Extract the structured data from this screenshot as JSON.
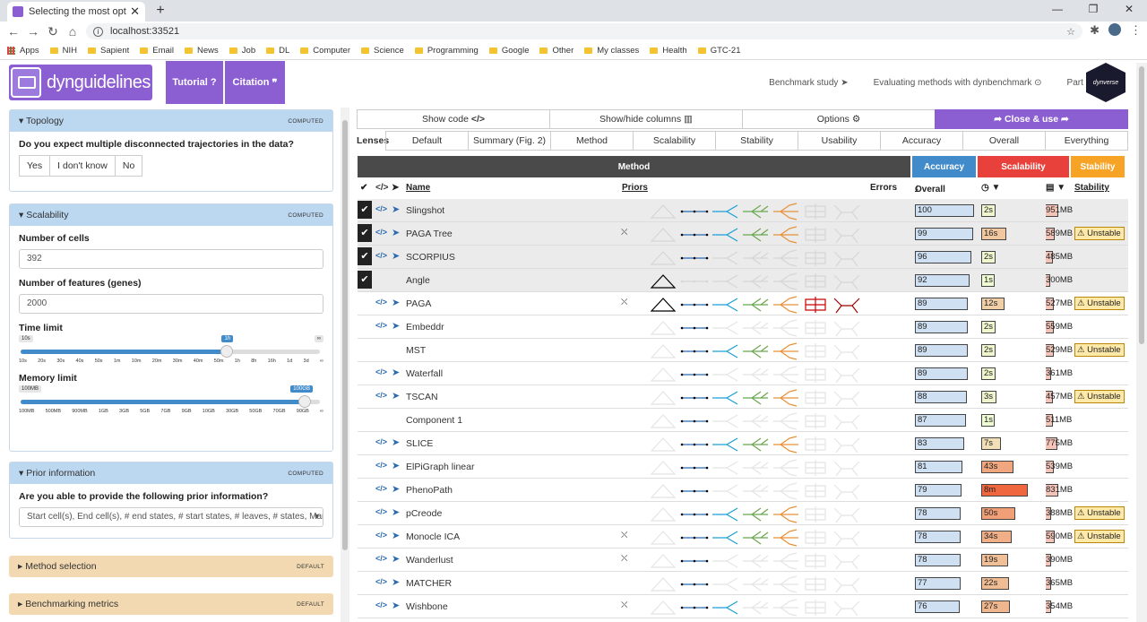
{
  "browser": {
    "tab_title": "Selecting the most optimal TI me",
    "url": "localhost:33521",
    "bookmarks": [
      "Apps",
      "NIH",
      "Sapient",
      "Email",
      "News",
      "Job",
      "DL",
      "Computer",
      "Science",
      "Programming",
      "Google",
      "Other",
      "My classes",
      "Health",
      "GTC-21"
    ]
  },
  "header": {
    "logo_text": "dynguidelines",
    "tutorial_label": "Tutorial",
    "citation_label": "Citation",
    "links": [
      "Benchmark study",
      "Evaluating methods with dynbenchmark",
      "Part of"
    ],
    "dynverse": "dynverse"
  },
  "left": {
    "topology": {
      "title": "Topology",
      "tag": "COMPUTED",
      "question": "Do you expect multiple disconnected trajectories in the data?",
      "options": [
        "Yes",
        "I don't know",
        "No"
      ]
    },
    "scalability": {
      "title": "Scalability",
      "tag": "COMPUTED",
      "cells_label": "Number of cells",
      "cells_value": "392",
      "features_label": "Number of features (genes)",
      "features_value": "2000",
      "time_label": "Time limit",
      "time_min": "10s",
      "time_sel": "1h",
      "time_max": "∞",
      "time_ticks": [
        "10s",
        "20s",
        "30s",
        "40s",
        "50s",
        "1m",
        "10m",
        "20m",
        "30m",
        "40m",
        "50m",
        "1h",
        "8h",
        "16h",
        "1d",
        "3d",
        "∞"
      ],
      "time_level": 0.69,
      "mem_label": "Memory limit",
      "mem_min": "100MB",
      "mem_sel": "100GB",
      "mem_ticks": [
        "100MB",
        "500MB",
        "900MB",
        "1GB",
        "3GB",
        "5GB",
        "7GB",
        "9GB",
        "10GB",
        "30GB",
        "50GB",
        "70GB",
        "90GB",
        "∞"
      ],
      "mem_level": 0.95
    },
    "prior": {
      "title": "Prior information",
      "tag": "COMPUTED",
      "question": "Are you able to provide the following prior information?",
      "value": "Start cell(s), End cell(s), # end states, # start states, # leaves, # states, Marke"
    },
    "method_selection": {
      "title": "Method selection",
      "tag": "DEFAULT"
    },
    "benchmarking": {
      "title": "Benchmarking metrics",
      "tag": "DEFAULT"
    }
  },
  "right": {
    "toolbar": [
      "Show code",
      "Show/hide columns",
      "Options",
      "Close & use"
    ],
    "lenses_label": "Lenses",
    "lenses": [
      "Default",
      "Summary (Fig. 2)",
      "Method",
      "Scalability",
      "Stability",
      "Usability",
      "Accuracy",
      "Overall",
      "Everything"
    ],
    "groups": [
      "Method",
      "Accuracy",
      "Scalability",
      "Stability"
    ],
    "columns": {
      "name": "Name",
      "priors": "Priors",
      "errors": "Errors",
      "overall": "Overall",
      "stability": "Stability"
    },
    "colors": {
      "method": "#4a4a4a",
      "accuracy": "#428bca",
      "scalability": "#e8413b",
      "stability": "#f7a325"
    },
    "rows": [
      {
        "name": "Slingshot",
        "sel": true,
        "code": true,
        "plane": true,
        "prior": "",
        "acc": "100",
        "accf": 1.0,
        "time": "2s",
        "timef": 0.05,
        "mem": "951MB",
        "memf": 0.9,
        "unstable": "",
        "topo": [
          0,
          1,
          1,
          1,
          1,
          0,
          0
        ]
      },
      {
        "name": "PAGA Tree",
        "sel": true,
        "code": true,
        "plane": true,
        "prior": "⛌",
        "acc": "99",
        "accf": 0.99,
        "time": "16s",
        "timef": 0.35,
        "mem": "589MB",
        "memf": 0.6,
        "unstable": "Unstable",
        "topo": [
          0,
          1,
          1,
          1,
          1,
          0,
          0
        ]
      },
      {
        "name": "SCORPIUS",
        "sel": true,
        "code": true,
        "plane": true,
        "prior": "",
        "acc": "96",
        "accf": 0.96,
        "time": "2s",
        "timef": 0.05,
        "mem": "485MB",
        "memf": 0.5,
        "unstable": "",
        "topo": [
          0,
          1,
          0,
          0,
          0,
          0,
          0
        ]
      },
      {
        "name": "Angle",
        "sel": true,
        "code": false,
        "plane": false,
        "prior": "",
        "acc": "92",
        "accf": 0.92,
        "time": "1s",
        "timef": 0.02,
        "mem": "300MB",
        "memf": 0.3,
        "unstable": "",
        "topo": [
          1,
          0,
          0,
          0,
          0,
          0,
          0
        ]
      },
      {
        "name": "PAGA",
        "sel": false,
        "code": true,
        "plane": true,
        "prior": "⛌",
        "acc": "89",
        "accf": 0.89,
        "time": "12s",
        "timef": 0.3,
        "mem": "527MB",
        "memf": 0.55,
        "unstable": "Unstable",
        "topo": [
          1,
          1,
          1,
          1,
          1,
          1,
          1
        ]
      },
      {
        "name": "Embeddr",
        "sel": false,
        "code": true,
        "plane": true,
        "prior": "",
        "acc": "89",
        "accf": 0.89,
        "time": "2s",
        "timef": 0.05,
        "mem": "559MB",
        "memf": 0.58,
        "unstable": "",
        "topo": [
          0,
          1,
          0,
          0,
          0,
          0,
          0
        ]
      },
      {
        "name": "MST",
        "sel": false,
        "code": false,
        "plane": false,
        "prior": "",
        "acc": "89",
        "accf": 0.89,
        "time": "2s",
        "timef": 0.05,
        "mem": "529MB",
        "memf": 0.55,
        "unstable": "Unstable",
        "topo": [
          0,
          1,
          1,
          1,
          1,
          0,
          0
        ]
      },
      {
        "name": "Waterfall",
        "sel": false,
        "code": true,
        "plane": true,
        "prior": "",
        "acc": "89",
        "accf": 0.89,
        "time": "2s",
        "timef": 0.05,
        "mem": "361MB",
        "memf": 0.38,
        "unstable": "",
        "topo": [
          0,
          1,
          0,
          0,
          0,
          0,
          0
        ]
      },
      {
        "name": "TSCAN",
        "sel": false,
        "code": true,
        "plane": true,
        "prior": "",
        "acc": "88",
        "accf": 0.88,
        "time": "3s",
        "timef": 0.07,
        "mem": "457MB",
        "memf": 0.48,
        "unstable": "Unstable",
        "topo": [
          0,
          1,
          1,
          1,
          1,
          0,
          0
        ]
      },
      {
        "name": "Component 1",
        "sel": false,
        "code": false,
        "plane": false,
        "prior": "",
        "acc": "87",
        "accf": 0.87,
        "time": "1s",
        "timef": 0.02,
        "mem": "511MB",
        "memf": 0.53,
        "unstable": "",
        "topo": [
          0,
          1,
          0,
          0,
          0,
          0,
          0
        ]
      },
      {
        "name": "SLICE",
        "sel": false,
        "code": true,
        "plane": true,
        "prior": "",
        "acc": "83",
        "accf": 0.83,
        "time": "7s",
        "timef": 0.2,
        "mem": "775MB",
        "memf": 0.8,
        "unstable": "",
        "topo": [
          0,
          1,
          1,
          1,
          1,
          0,
          0
        ]
      },
      {
        "name": "ElPiGraph linear",
        "sel": false,
        "code": true,
        "plane": true,
        "prior": "",
        "acc": "81",
        "accf": 0.81,
        "time": "43s",
        "timef": 0.55,
        "mem": "539MB",
        "memf": 0.56,
        "unstable": "",
        "topo": [
          0,
          1,
          0,
          0,
          0,
          0,
          0
        ]
      },
      {
        "name": "PhenoPath",
        "sel": false,
        "code": true,
        "plane": true,
        "prior": "",
        "acc": "79",
        "accf": 0.79,
        "time": "8m",
        "timef": 0.95,
        "mem": "831MB",
        "memf": 0.86,
        "unstable": "",
        "topo": [
          0,
          1,
          0,
          0,
          0,
          0,
          0
        ]
      },
      {
        "name": "pCreode",
        "sel": false,
        "code": true,
        "plane": true,
        "prior": "",
        "acc": "78",
        "accf": 0.78,
        "time": "50s",
        "timef": 0.6,
        "mem": "388MB",
        "memf": 0.4,
        "unstable": "Unstable",
        "topo": [
          0,
          1,
          1,
          1,
          1,
          0,
          0
        ]
      },
      {
        "name": "Monocle ICA",
        "sel": false,
        "code": true,
        "plane": true,
        "prior": "⛌",
        "acc": "78",
        "accf": 0.78,
        "time": "34s",
        "timef": 0.5,
        "mem": "590MB",
        "memf": 0.62,
        "unstable": "Unstable",
        "topo": [
          0,
          1,
          1,
          1,
          1,
          0,
          0
        ]
      },
      {
        "name": "Wanderlust",
        "sel": false,
        "code": true,
        "plane": true,
        "prior": "⛌",
        "acc": "78",
        "accf": 0.78,
        "time": "19s",
        "timef": 0.4,
        "mem": "390MB",
        "memf": 0.4,
        "unstable": "",
        "topo": [
          0,
          1,
          0,
          0,
          0,
          0,
          0
        ]
      },
      {
        "name": "MATCHER",
        "sel": false,
        "code": true,
        "plane": true,
        "prior": "",
        "acc": "77",
        "accf": 0.77,
        "time": "22s",
        "timef": 0.42,
        "mem": "365MB",
        "memf": 0.38,
        "unstable": "",
        "topo": [
          0,
          1,
          0,
          0,
          0,
          0,
          0
        ]
      },
      {
        "name": "Wishbone",
        "sel": false,
        "code": true,
        "plane": true,
        "prior": "⛌",
        "acc": "76",
        "accf": 0.76,
        "time": "27s",
        "timef": 0.45,
        "mem": "354MB",
        "memf": 0.37,
        "unstable": "",
        "topo": [
          0,
          1,
          1,
          0,
          0,
          0,
          0
        ]
      }
    ]
  }
}
